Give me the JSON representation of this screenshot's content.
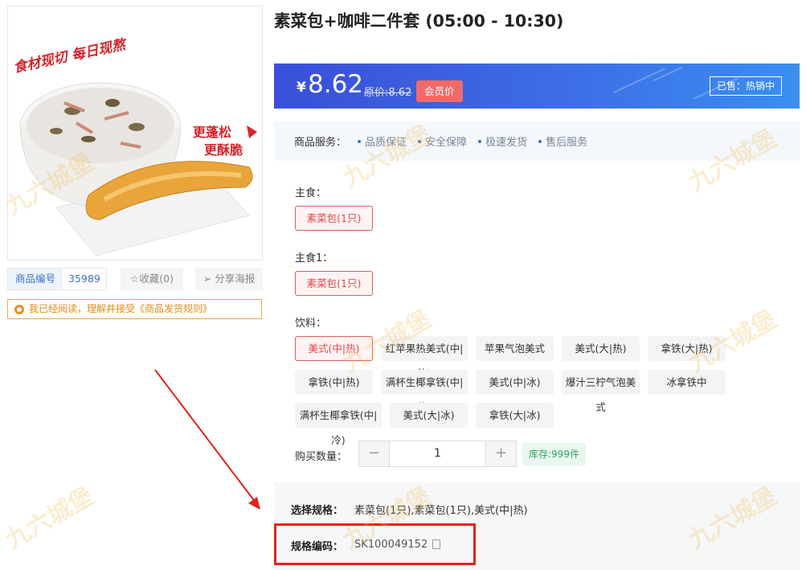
{
  "product": {
    "title": "素菜包+咖啡二件套 (05:00 - 10:30)",
    "image_text_top": "食材现切 每日现熬",
    "image_text_side": "更蓬松 更酥脆",
    "code_label": "商品编号",
    "code_value": "35989",
    "favorite_label": "☆收藏(0)",
    "share_label": "分享海报",
    "agree_text": "我已经阅读，理解并接受《商品发货规则》"
  },
  "price": {
    "currency": "¥",
    "value": "8.62",
    "original": "原价:8.62",
    "member_tag": "会员价",
    "sold_tag": "已售：热销中"
  },
  "services": {
    "label": "商品服务：",
    "items": [
      "品质保证",
      "安全保障",
      "极速发货",
      "售后服务"
    ]
  },
  "options": {
    "group1": {
      "label": "主食：",
      "items": [
        "素菜包(1只)"
      ]
    },
    "group2": {
      "label": "主食1：",
      "items": [
        "素菜包(1只)"
      ]
    },
    "group3": {
      "label": "饮料：",
      "items": [
        "美式(中|热)",
        "红苹果热美式(中|热)",
        "苹果气泡美式",
        "美式(大|热)",
        "拿铁(大|热)",
        "拿铁(中|热)",
        "满杯生椰拿铁(中|热)",
        "美式(中|冰)",
        "爆汁三柠气泡美式",
        "冰拿铁中",
        "满杯生椰拿铁(中|冷)",
        "美式(大|冰)",
        "拿铁(大|冰)"
      ]
    }
  },
  "quantity": {
    "label": "购买数量：",
    "minus": "−",
    "plus": "+",
    "value": "1",
    "stock": "库存:999件"
  },
  "spec": {
    "selected_label": "选择规格：",
    "selected_value": "素菜包(1只),素菜包(1只),美式(中|热)",
    "code_label": "规格编码：",
    "code_value": "SK100049152"
  },
  "watermark": "九六城堡",
  "colors": {
    "banner_start": "#3a4fd8",
    "banner_end": "#3a8ff0",
    "selected_red": "#e04a4a",
    "highlight_red": "#e2231a",
    "stock_green": "#35a463"
  }
}
